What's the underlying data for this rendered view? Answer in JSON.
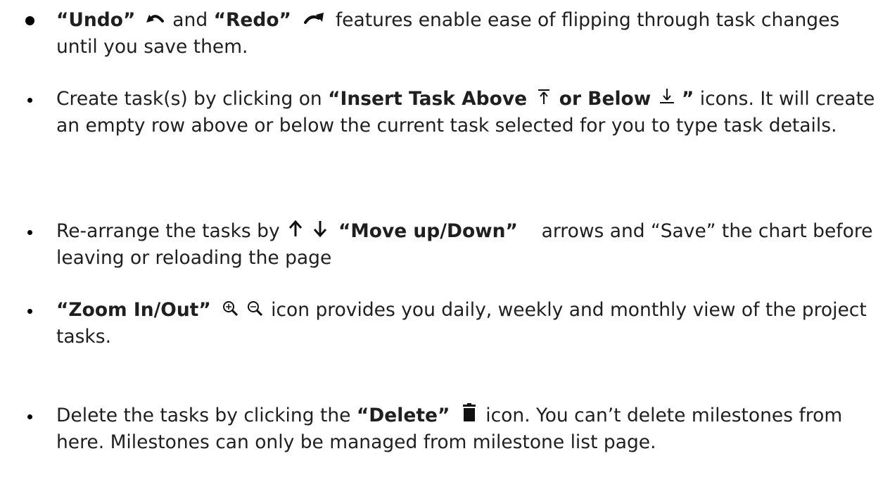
{
  "items": [
    {
      "undo_label": "“Undo”",
      "and": " and ",
      "redo_label": "“Redo”",
      "text": " features enable ease of flipping through task changes until you save them."
    },
    {
      "text_before": "Create task(s) by clicking on ",
      "insert_above_label": "“Insert Task Above ",
      "or_below_label": " or Below ",
      "close_quote": " ”",
      "text_after": " icons. It will create an empty row above or below the current task selected for you to type task details."
    },
    {
      "text_before": "Re-arrange the tasks by ",
      "move_label": "“Move up/Down”",
      "text_after": "   arrows and “Save” the chart before leaving or reloading the page"
    },
    {
      "zoom_label": "“Zoom In/Out”",
      "text_after": " icon provides you daily, weekly and monthly view of the project tasks."
    },
    {
      "text_before": "Delete the tasks by clicking the ",
      "delete_label": "“Delete”",
      "text_after": " icon. You can’t delete milestones from here. Milestones can only be managed from milestone list page."
    }
  ],
  "icons": {
    "undo": "undo-icon",
    "redo": "redo-icon",
    "insert_above": "insert-above-icon",
    "insert_below": "insert-below-icon",
    "move_up": "arrow-up-icon",
    "move_down": "arrow-down-icon",
    "zoom_in": "zoom-in-icon",
    "zoom_out": "zoom-out-icon",
    "delete": "trash-icon"
  }
}
